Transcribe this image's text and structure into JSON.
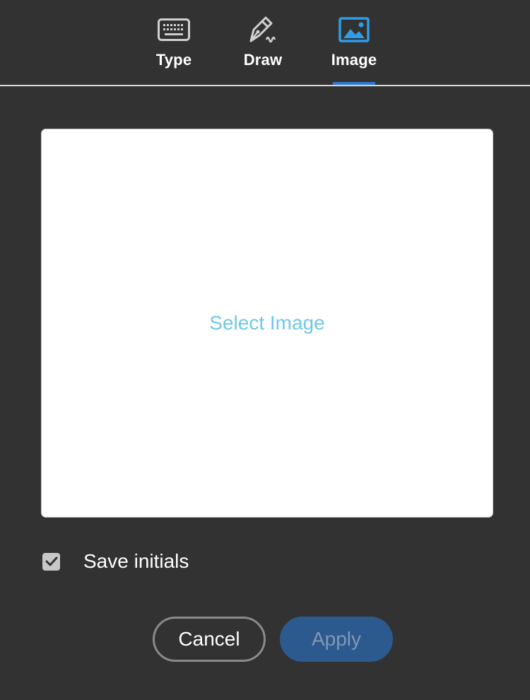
{
  "tabs": [
    {
      "label": "Type",
      "icon": "keyboard-icon",
      "selected": false
    },
    {
      "label": "Draw",
      "icon": "pen-icon",
      "selected": false
    },
    {
      "label": "Image",
      "icon": "image-icon",
      "selected": true
    }
  ],
  "image_area": {
    "select_label": "Select Image"
  },
  "save_initials": {
    "label": "Save initials",
    "checked": true
  },
  "buttons": {
    "cancel_label": "Cancel",
    "apply_label": "Apply"
  },
  "colors": {
    "background": "#323232",
    "accent": "#2f7ad6",
    "link": "#6fc8ea",
    "apply_disabled": "#2c5a8f"
  }
}
